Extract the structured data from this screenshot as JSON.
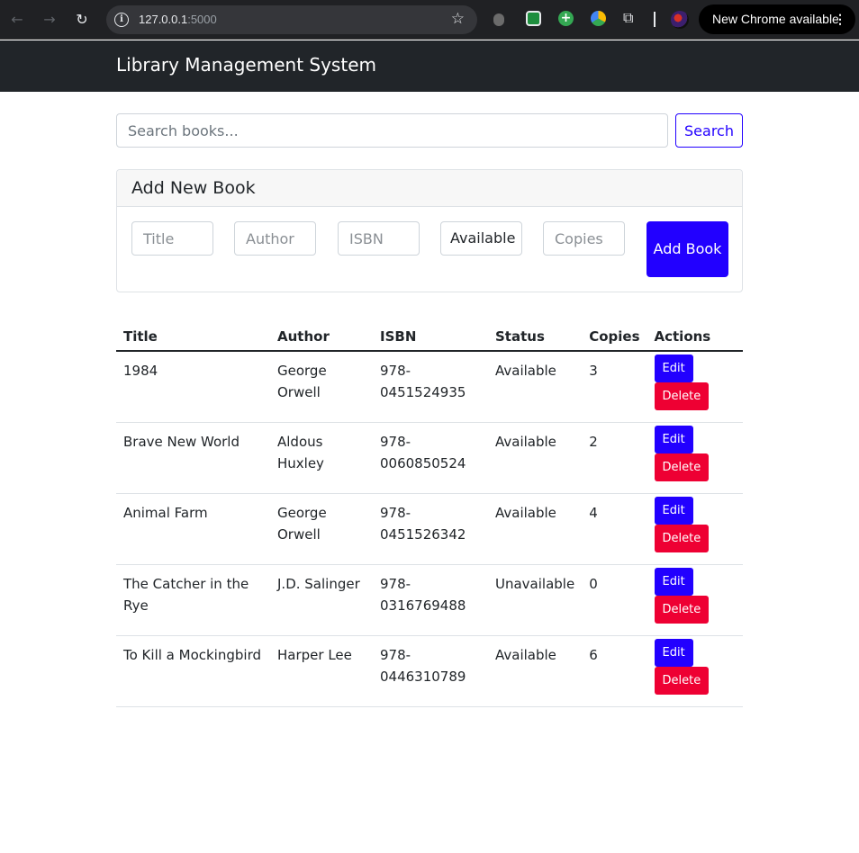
{
  "browser": {
    "url_host": "127.0.0.1",
    "url_port": ":5000",
    "update_label": "New Chrome available",
    "menu_glyph": "⋮"
  },
  "navbar": {
    "brand": "Library Management System"
  },
  "search": {
    "placeholder": "Search books...",
    "button_label": "Search"
  },
  "add_form": {
    "title": "Add New Book",
    "title_placeholder": "Title",
    "author_placeholder": "Author",
    "isbn_placeholder": "ISBN",
    "status_value": "Available",
    "copies_placeholder": "Copies",
    "button_label": "Add Book"
  },
  "table": {
    "headers": [
      "Title",
      "Author",
      "ISBN",
      "Status",
      "Copies",
      "Actions"
    ],
    "edit_label": "Edit",
    "delete_label": "Delete",
    "rows": [
      {
        "title": "1984",
        "author": "George Orwell",
        "isbn": "978-0451524935",
        "status": "Available",
        "copies": "3"
      },
      {
        "title": "Brave New World",
        "author": "Aldous Huxley",
        "isbn": "978-0060850524",
        "status": "Available",
        "copies": "2"
      },
      {
        "title": "Animal Farm",
        "author": "George Orwell",
        "isbn": "978-0451526342",
        "status": "Available",
        "copies": "4"
      },
      {
        "title": "The Catcher in the Rye",
        "author": "J.D. Salinger",
        "isbn": "978-0316769488",
        "status": "Unavailable",
        "copies": "0"
      },
      {
        "title": "To Kill a Mockingbird",
        "author": "Harper Lee",
        "isbn": "978-0446310789",
        "status": "Available",
        "copies": "6"
      }
    ]
  },
  "colors": {
    "primary": "#2200ff",
    "danger": "#ee0033",
    "navbar": "#212529"
  }
}
